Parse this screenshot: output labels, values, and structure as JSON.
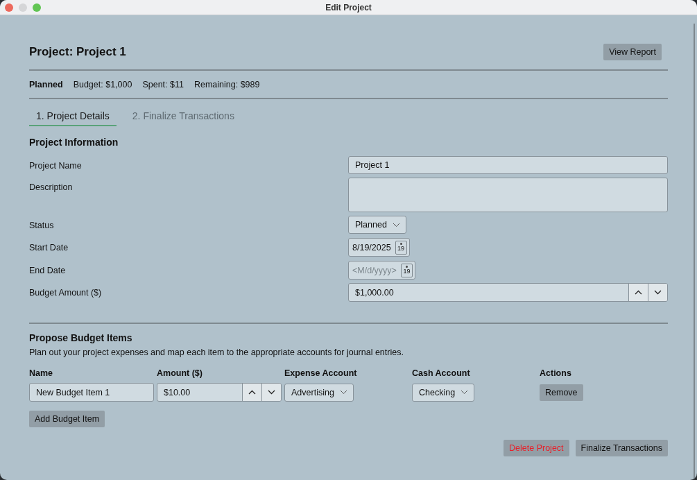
{
  "window": {
    "title": "Edit Project"
  },
  "header": {
    "title": "Project: Project 1",
    "view_report": "View Report"
  },
  "summary": {
    "status": "Planned",
    "budget": "Budget: $1,000",
    "spent": "Spent: $11",
    "remaining": "Remaining: $989"
  },
  "tabs": [
    {
      "label": "1. Project Details",
      "selected": true
    },
    {
      "label": "2. Finalize Transactions",
      "selected": false
    }
  ],
  "project_information": {
    "title": "Project Information",
    "fields": [
      {
        "kind": "text",
        "label": "Project Name",
        "value": "Project 1"
      },
      {
        "kind": "textarea",
        "label": "Description"
      },
      {
        "kind": "select",
        "label": "Status",
        "value": "Planned"
      },
      {
        "kind": "date",
        "label": "Start Date",
        "value": "8/19/2025",
        "icon_label": "19"
      },
      {
        "kind": "date",
        "label": "End Date",
        "placeholder": "<M/d/yyyy>",
        "icon_label": "19"
      },
      {
        "kind": "number",
        "label": "Budget Amount ($)",
        "value": "$1,000.00"
      }
    ]
  },
  "budget_items": {
    "title": "Propose Budget Items",
    "description": "Plan out your project expenses and map each item to the appropriate accounts for journal entries.",
    "columns": [
      "Name",
      "Amount ($)",
      "Expense Account",
      "Cash Account",
      "Actions"
    ],
    "rows": [
      {
        "name": "New Budget Item 1",
        "amount": "$10.00",
        "expense_account": "Advertising",
        "cash_account": "Checking",
        "action": "Remove"
      }
    ],
    "add_button": "Add Budget Item"
  },
  "footer": {
    "delete": "Delete Project",
    "finalize": "Finalize Transactions"
  }
}
